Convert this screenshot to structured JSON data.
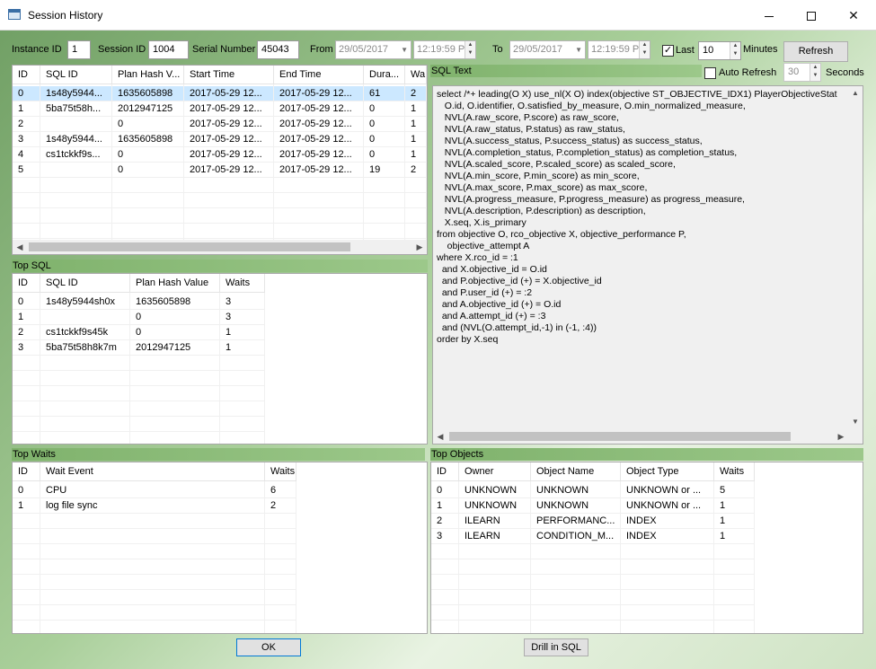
{
  "window": {
    "title": "Session History"
  },
  "toolbar": {
    "instance_label": "Instance ID",
    "instance_value": "1",
    "session_label": "Session ID",
    "session_value": "1004",
    "serial_label": "Serial Number",
    "serial_value": "45043",
    "from_label": "From",
    "from_date": "29/05/2017",
    "from_time": "12:19:59 P",
    "to_label": "To",
    "to_date": "29/05/2017",
    "to_time": "12:19:59 P",
    "last_label": "Last",
    "last_checked": true,
    "last_value": "10",
    "minutes_label": "Minutes",
    "refresh_label": "Refresh",
    "auto_refresh_label": "Auto Refresh",
    "auto_refresh_value": "30",
    "seconds_label": "Seconds"
  },
  "history": {
    "columns": [
      "ID",
      "SQL ID",
      "Plan Hash V...",
      "Start Time",
      "End Time",
      "Dura...",
      "Wa"
    ],
    "rows": [
      [
        "0",
        "1s48y5944...",
        "1635605898",
        "2017-05-29 12...",
        "2017-05-29 12...",
        "61",
        "2"
      ],
      [
        "1",
        "5ba75t58h...",
        "2012947125",
        "2017-05-29 12...",
        "2017-05-29 12...",
        "0",
        "1"
      ],
      [
        "2",
        "",
        "0",
        "2017-05-29 12...",
        "2017-05-29 12...",
        "0",
        "1"
      ],
      [
        "3",
        "1s48y5944...",
        "1635605898",
        "2017-05-29 12...",
        "2017-05-29 12...",
        "0",
        "1"
      ],
      [
        "4",
        "cs1tckkf9s...",
        "0",
        "2017-05-29 12...",
        "2017-05-29 12...",
        "0",
        "1"
      ],
      [
        "5",
        "",
        "0",
        "2017-05-29 12...",
        "2017-05-29 12...",
        "19",
        "2"
      ]
    ]
  },
  "sql_text": {
    "title": "SQL Text",
    "lines": [
      "select /*+ leading(O X) use_nl(X O) index(objective ST_OBJECTIVE_IDX1) PlayerObjectiveStat",
      "   O.id, O.identifier, O.satisfied_by_measure, O.min_normalized_measure,",
      "   NVL(A.raw_score, P.score) as raw_score,",
      "   NVL(A.raw_status, P.status) as raw_status,",
      "   NVL(A.success_status, P.success_status) as success_status,",
      "   NVL(A.completion_status, P.completion_status) as completion_status,",
      "   NVL(A.scaled_score, P.scaled_score) as scaled_score,",
      "   NVL(A.min_score, P.min_score) as min_score,",
      "   NVL(A.max_score, P.max_score) as max_score,",
      "   NVL(A.progress_measure, P.progress_measure) as progress_measure,",
      "   NVL(A.description, P.description) as description,",
      "   X.seq, X.is_primary",
      "from objective O, rco_objective X, objective_performance P,",
      "    objective_attempt A",
      "where X.rco_id = :1",
      "  and X.objective_id = O.id",
      "  and P.objective_id (+) = X.objective_id",
      "  and P.user_id (+) = :2",
      "  and A.objective_id (+) = O.id",
      "  and A.attempt_id (+) = :3",
      "  and (NVL(O.attempt_id,-1) in (-1, :4))",
      "order by X.seq"
    ]
  },
  "top_sql": {
    "title": "Top SQL",
    "columns": [
      "ID",
      "SQL ID",
      "Plan Hash Value",
      "Waits"
    ],
    "rows": [
      [
        "0",
        "1s48y5944sh0x",
        "1635605898",
        "3"
      ],
      [
        "1",
        "",
        "0",
        "3"
      ],
      [
        "2",
        "cs1tckkf9s45k",
        "0",
        "1"
      ],
      [
        "3",
        "5ba75t58h8k7m",
        "2012947125",
        "1"
      ]
    ]
  },
  "top_waits": {
    "title": "Top Waits",
    "columns": [
      "ID",
      "Wait Event",
      "Waits"
    ],
    "rows": [
      [
        "0",
        "CPU",
        "6"
      ],
      [
        "1",
        "log file sync",
        "2"
      ]
    ]
  },
  "top_objects": {
    "title": "Top Objects",
    "columns": [
      "ID",
      "Owner",
      "Object Name",
      "Object Type",
      "Waits"
    ],
    "rows": [
      [
        "0",
        "UNKNOWN",
        "UNKNOWN",
        "UNKNOWN or ...",
        "5"
      ],
      [
        "1",
        "UNKNOWN",
        "UNKNOWN",
        "UNKNOWN or ...",
        "1"
      ],
      [
        "2",
        "ILEARN",
        "PERFORMANC...",
        "INDEX",
        "1"
      ],
      [
        "3",
        "ILEARN",
        "CONDITION_M...",
        "INDEX",
        "1"
      ]
    ]
  },
  "footer": {
    "ok_label": "OK",
    "drill_label": "Drill in SQL"
  }
}
